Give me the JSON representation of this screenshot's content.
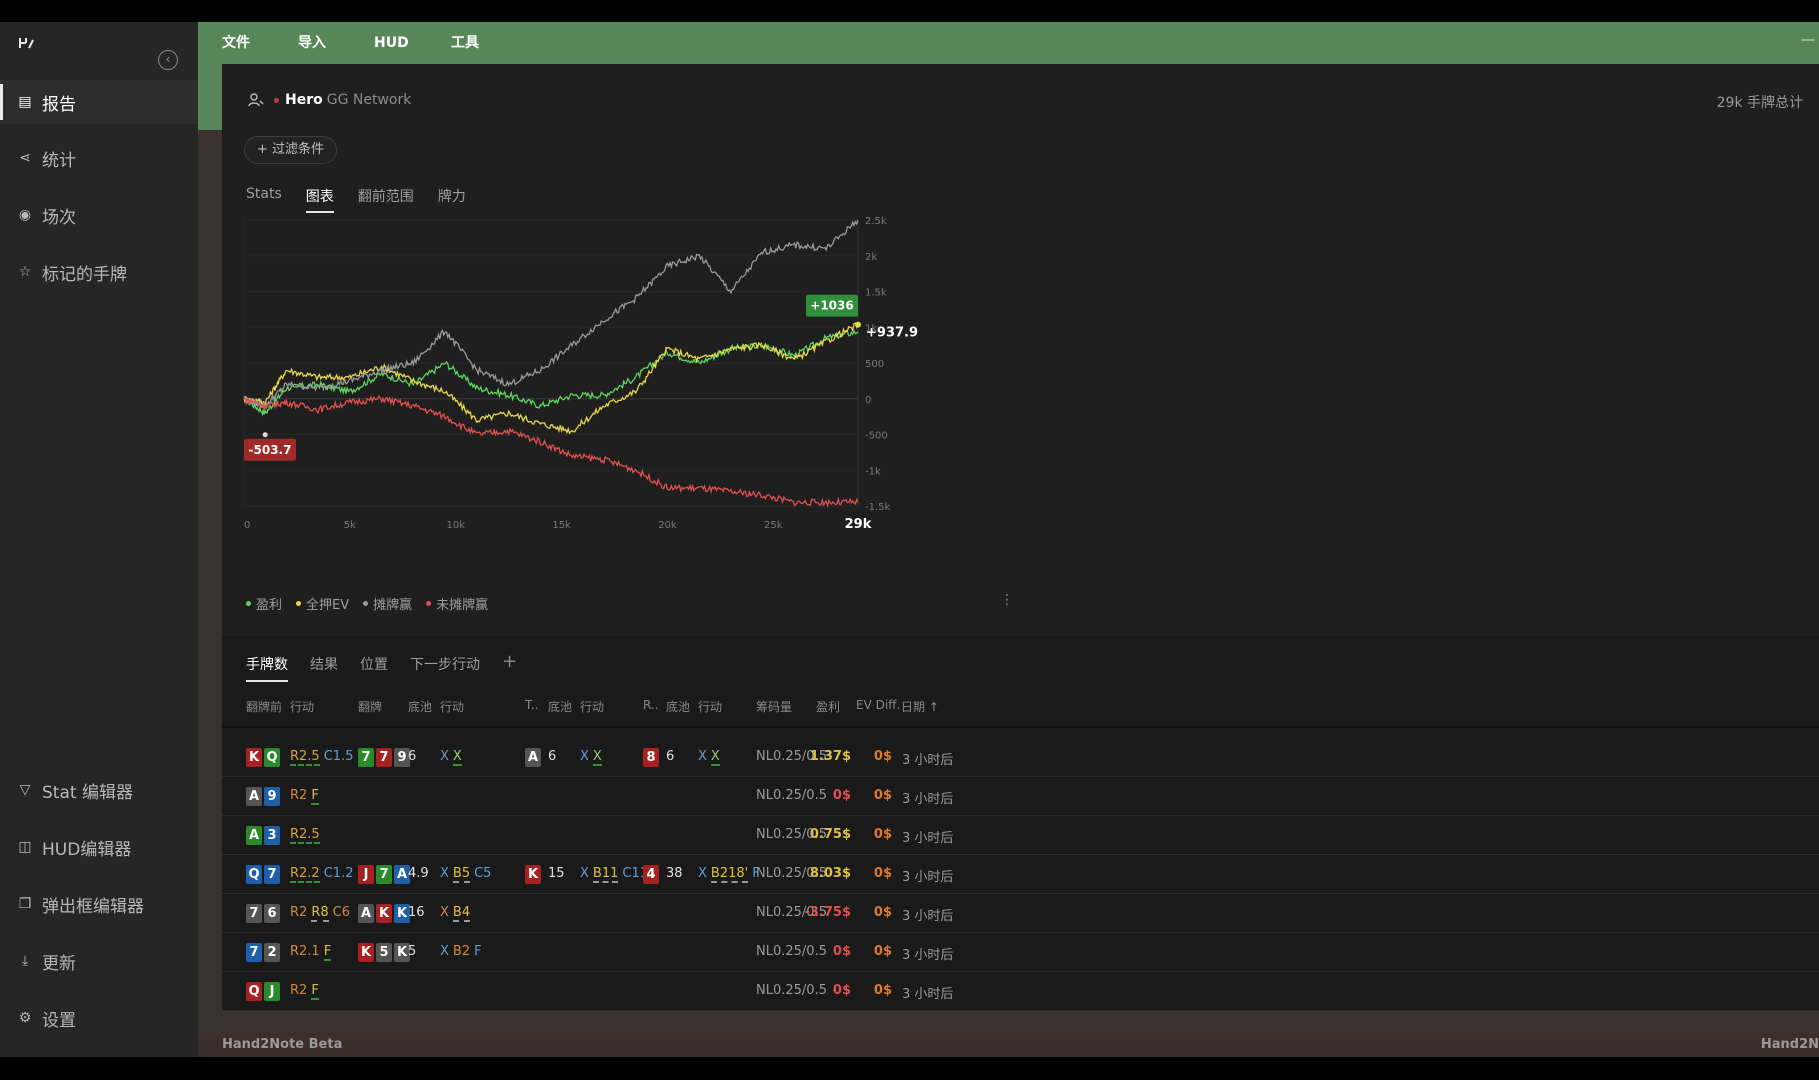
{
  "sidebar": {
    "logo": "hand2note-logo",
    "items": [
      {
        "label": "报告",
        "icon": "report-icon"
      },
      {
        "label": "统计",
        "icon": "share-nodes-icon"
      },
      {
        "label": "场次",
        "icon": "broadcast-icon"
      },
      {
        "label": "标记的手牌",
        "icon": "star-list-icon"
      },
      {
        "label": "Stat 编辑器",
        "icon": "filter-icon"
      },
      {
        "label": "HUD编辑器",
        "icon": "layout-icon"
      },
      {
        "label": "弹出框编辑器",
        "icon": "popup-icon"
      },
      {
        "label": "更新",
        "icon": "download-icon"
      },
      {
        "label": "设置",
        "icon": "gear-icon"
      }
    ]
  },
  "menu": [
    "文件",
    "导入",
    "HUD",
    "工具"
  ],
  "window": {
    "minimize": "—"
  },
  "player": {
    "name": "Hero",
    "network": "GG Network"
  },
  "total_hands": "29k 手牌总计",
  "filter_label": "+ 过滤条件",
  "chart_tabs": [
    "Stats",
    "图表",
    "翻前范围",
    "牌力"
  ],
  "chart_tab_active": 1,
  "chart_data": {
    "type": "line",
    "xlabel": "",
    "ylabel": "",
    "x_ticks": [
      "0",
      "5k",
      "10k",
      "15k",
      "20k",
      "25k",
      "29k"
    ],
    "y_ticks": [
      "2.5k",
      "2k",
      "1.5k",
      "1k",
      "500",
      "0",
      "-500",
      "-1k",
      "-1.5k"
    ],
    "ylim": [
      -1500,
      2500
    ],
    "xlim": [
      0,
      29000
    ],
    "grid": true,
    "labels": {
      "max_badge": "+1036",
      "end_value": "+937.9",
      "min_badge": "-503.7",
      "end_x": "29k"
    },
    "series": [
      {
        "name": "盈利",
        "color": "#5fd45f",
        "x": [
          0,
          1000,
          2000,
          3500,
          5000,
          6500,
          8000,
          9500,
          11000,
          12500,
          14000,
          15500,
          17000,
          18500,
          20000,
          21500,
          23000,
          24500,
          26000,
          27500,
          29000
        ],
        "y": [
          0,
          -200,
          150,
          200,
          100,
          350,
          200,
          500,
          150,
          50,
          -100,
          50,
          50,
          300,
          650,
          500,
          700,
          750,
          600,
          850,
          938
        ]
      },
      {
        "name": "全押EV",
        "color": "#e8d84a",
        "x": [
          0,
          1000,
          2000,
          3500,
          5000,
          6500,
          8000,
          9500,
          11000,
          12500,
          14000,
          15500,
          17000,
          18500,
          20000,
          21500,
          23000,
          24500,
          26000,
          27500,
          29000
        ],
        "y": [
          0,
          -50,
          400,
          300,
          300,
          450,
          250,
          100,
          -300,
          -200,
          -350,
          -450,
          -100,
          100,
          700,
          550,
          700,
          750,
          550,
          800,
          1036
        ]
      },
      {
        "name": "摊牌赢",
        "color": "#9a9a9a",
        "x": [
          0,
          1000,
          2000,
          3500,
          5000,
          6500,
          8000,
          9500,
          11000,
          12500,
          14000,
          15500,
          17000,
          18500,
          20000,
          21500,
          23000,
          24500,
          26000,
          27500,
          29000
        ],
        "y": [
          0,
          -100,
          200,
          150,
          250,
          400,
          500,
          950,
          400,
          200,
          400,
          750,
          1100,
          1400,
          1850,
          2000,
          1500,
          2050,
          2150,
          2100,
          2500
        ]
      },
      {
        "name": "未摊牌赢",
        "color": "#e05050",
        "x": [
          0,
          1000,
          2000,
          3500,
          5000,
          6500,
          8000,
          9500,
          11000,
          12500,
          14000,
          15500,
          17000,
          18500,
          20000,
          21500,
          23000,
          24500,
          26000,
          27500,
          29000
        ],
        "y": [
          0,
          -100,
          -50,
          -150,
          -50,
          0,
          -100,
          -250,
          -500,
          -450,
          -600,
          -800,
          -850,
          -1000,
          -1250,
          -1250,
          -1300,
          -1350,
          -1450,
          -1450,
          -1450
        ]
      }
    ]
  },
  "table": {
    "tabs": [
      "手牌数",
      "结果",
      "位置",
      "下一步行动"
    ],
    "add": "+",
    "headers": {
      "preflop": "翻牌前",
      "action1": "行动",
      "flop": "翻牌",
      "pot1": "底池",
      "action2": "行动",
      "turn": "T..",
      "pot2": "底池",
      "action3": "行动",
      "river": "R..",
      "pot3": "底池",
      "action4": "行动",
      "stakes": "筹码量",
      "won": "盈利",
      "evdiff": "EV Diff.",
      "date": "日期 ↑"
    },
    "rows": [
      {
        "pre": [
          "K",
          "Q"
        ],
        "pre_c": [
          "red",
          "green"
        ],
        "pre_act": [
          [
            "R2.5",
            "a-r"
          ],
          [
            "C1.5",
            "a-c"
          ]
        ],
        "flop": [
          "7",
          "7",
          "9"
        ],
        "flop_c": [
          "green",
          "red",
          "gray"
        ],
        "pot1": "6",
        "flop_act": [
          [
            "X",
            "a-x"
          ],
          [
            "X",
            "a-g"
          ]
        ],
        "turn": [
          "A"
        ],
        "turn_c": [
          "gray"
        ],
        "pot2": "6",
        "turn_act": [
          [
            "X",
            "a-x"
          ],
          [
            "X",
            "a-g"
          ]
        ],
        "river": [
          "8"
        ],
        "river_c": [
          "red"
        ],
        "pot3": "6",
        "river_act": [
          [
            "X",
            "a-x"
          ],
          [
            "X",
            "a-g"
          ]
        ],
        "stakes": "NL0.25/0.5",
        "won": "1.37$",
        "won_cls": "won-pos",
        "ev": "0$",
        "date": "3 小时后"
      },
      {
        "pre": [
          "A",
          "9"
        ],
        "pre_c": [
          "gray",
          "blue"
        ],
        "pre_act": [
          [
            "R2",
            "a-r2"
          ],
          [
            "F",
            "a-f"
          ]
        ],
        "flop": [],
        "flop_c": [],
        "pot1": "",
        "flop_act": [],
        "turn": [],
        "turn_c": [],
        "pot2": "",
        "turn_act": [],
        "river": [],
        "river_c": [],
        "pot3": "",
        "river_act": [],
        "stakes": "NL0.25/0.5",
        "won": "0$",
        "won_cls": "won-neg",
        "ev": "0$",
        "date": "3 小时后"
      },
      {
        "pre": [
          "A",
          "3"
        ],
        "pre_c": [
          "green",
          "blue"
        ],
        "pre_act": [
          [
            "R2.5",
            "a-r"
          ]
        ],
        "flop": [],
        "flop_c": [],
        "pot1": "",
        "flop_act": [],
        "turn": [],
        "turn_c": [],
        "pot2": "",
        "turn_act": [],
        "river": [],
        "river_c": [],
        "pot3": "",
        "river_act": [],
        "stakes": "NL0.25/0.5",
        "won": "0.75$",
        "won_cls": "won-pos",
        "ev": "0$",
        "date": "3 小时后"
      },
      {
        "pre": [
          "Q",
          "7"
        ],
        "pre_c": [
          "blue",
          "blue"
        ],
        "pre_act": [
          [
            "R2.2",
            "a-r"
          ],
          [
            "C1.2",
            "a-c"
          ]
        ],
        "flop": [
          "J",
          "7",
          "A"
        ],
        "flop_c": [
          "red",
          "green",
          "blue"
        ],
        "pot1": "4.9",
        "flop_act": [
          [
            "X",
            "a-x"
          ],
          [
            "B5",
            "a-b"
          ],
          [
            "C5",
            "a-c"
          ]
        ],
        "turn": [
          "K"
        ],
        "turn_c": [
          "red"
        ],
        "pot2": "15",
        "turn_act": [
          [
            "X",
            "a-x"
          ],
          [
            "B11",
            "a-b"
          ],
          [
            "C11",
            "a-c"
          ]
        ],
        "river": [
          "4"
        ],
        "river_c": [
          "red"
        ],
        "pot3": "38",
        "river_act": [
          [
            "X",
            "a-x"
          ],
          [
            "B218'",
            "a-b"
          ],
          [
            "F",
            "a-c"
          ]
        ],
        "stakes": "NL0.25/0.5",
        "won": "8.03$",
        "won_cls": "won-pos",
        "ev": "0$",
        "date": "3 小时后"
      },
      {
        "pre": [
          "7",
          "6"
        ],
        "pre_c": [
          "gray",
          "gray"
        ],
        "pre_act": [
          [
            "R2",
            "a-r2"
          ],
          [
            "R8",
            "a-b"
          ],
          [
            "C6",
            "a-r2"
          ]
        ],
        "flop": [
          "A",
          "K",
          "K"
        ],
        "flop_c": [
          "gray",
          "red",
          "blue"
        ],
        "pot1": "16",
        "flop_act": [
          [
            "X",
            "a-r2"
          ],
          [
            "B4",
            "a-b"
          ]
        ],
        "turn": [],
        "turn_c": [],
        "pot2": "",
        "turn_act": [],
        "river": [],
        "river_c": [],
        "pot3": "",
        "river_act": [],
        "stakes": "NL0.25/0.5",
        "won": "-3.75$",
        "won_cls": "won-neg",
        "ev": "0$",
        "date": "3 小时后"
      },
      {
        "pre": [
          "7",
          "2"
        ],
        "pre_c": [
          "blue",
          "gray"
        ],
        "pre_act": [
          [
            "R2.1",
            "a-r2"
          ],
          [
            "F",
            "a-f"
          ]
        ],
        "flop": [
          "K",
          "5",
          "K"
        ],
        "flop_c": [
          "red",
          "gray",
          "gray"
        ],
        "pot1": "5",
        "flop_act": [
          [
            "X",
            "a-x"
          ],
          [
            "B2",
            "a-r2"
          ],
          [
            "F",
            "a-c"
          ]
        ],
        "turn": [],
        "turn_c": [],
        "pot2": "",
        "turn_act": [],
        "river": [],
        "river_c": [],
        "pot3": "",
        "river_act": [],
        "stakes": "NL0.25/0.5",
        "won": "0$",
        "won_cls": "won-neg",
        "ev": "0$",
        "date": "3 小时后"
      },
      {
        "pre": [
          "Q",
          "J"
        ],
        "pre_c": [
          "red",
          "green"
        ],
        "pre_act": [
          [
            "R2",
            "a-r2"
          ],
          [
            "F",
            "a-f"
          ]
        ],
        "flop": [],
        "flop_c": [],
        "pot1": "",
        "flop_act": [],
        "turn": [],
        "turn_c": [],
        "pot2": "",
        "turn_act": [],
        "river": [],
        "river_c": [],
        "pot3": "",
        "river_act": [],
        "stakes": "NL0.25/0.5",
        "won": "0$",
        "won_cls": "won-neg",
        "ev": "0$",
        "date": "3 小时后"
      }
    ]
  },
  "status": {
    "left": "Hand2Note Beta",
    "right": "Hand2N"
  }
}
